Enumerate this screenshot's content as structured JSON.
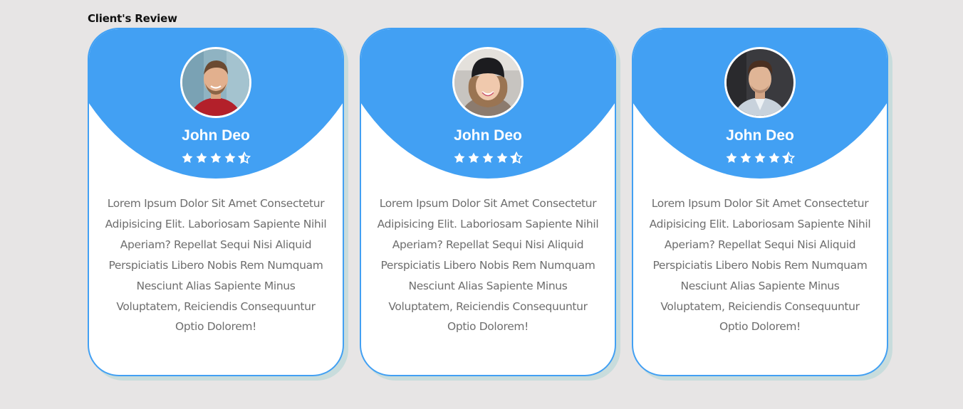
{
  "section": {
    "title": "Client's Review"
  },
  "colors": {
    "accent": "#42a0f3",
    "background": "#e7e5e5",
    "text_muted": "#6e6e6e"
  },
  "reviews": [
    {
      "name": "John Deo",
      "rating": 4.5,
      "rating_max": 5,
      "avatar_icon": "man-smiling-avatar",
      "text": "Lorem Ipsum Dolor Sit Amet Consectetur Adipisicing Elit. Laboriosam Sapiente Nihil Aperiam? Repellat Sequi Nisi Aliquid Perspiciatis Libero Nobis Rem Numquam Nesciunt Alias Sapiente Minus Voluptatem, Reiciendis Consequuntur Optio Dolorem!"
    },
    {
      "name": "John Deo",
      "rating": 4.5,
      "rating_max": 5,
      "avatar_icon": "woman-beanie-avatar",
      "text": "Lorem Ipsum Dolor Sit Amet Consectetur Adipisicing Elit. Laboriosam Sapiente Nihil Aperiam? Repellat Sequi Nisi Aliquid Perspiciatis Libero Nobis Rem Numquam Nesciunt Alias Sapiente Minus Voluptatem, Reiciendis Consequuntur Optio Dolorem!"
    },
    {
      "name": "John Deo",
      "rating": 4.5,
      "rating_max": 5,
      "avatar_icon": "man-suit-avatar",
      "text": "Lorem Ipsum Dolor Sit Amet Consectetur Adipisicing Elit. Laboriosam Sapiente Nihil Aperiam? Repellat Sequi Nisi Aliquid Perspiciatis Libero Nobis Rem Numquam Nesciunt Alias Sapiente Minus Voluptatem, Reiciendis Consequuntur Optio Dolorem!"
    }
  ]
}
